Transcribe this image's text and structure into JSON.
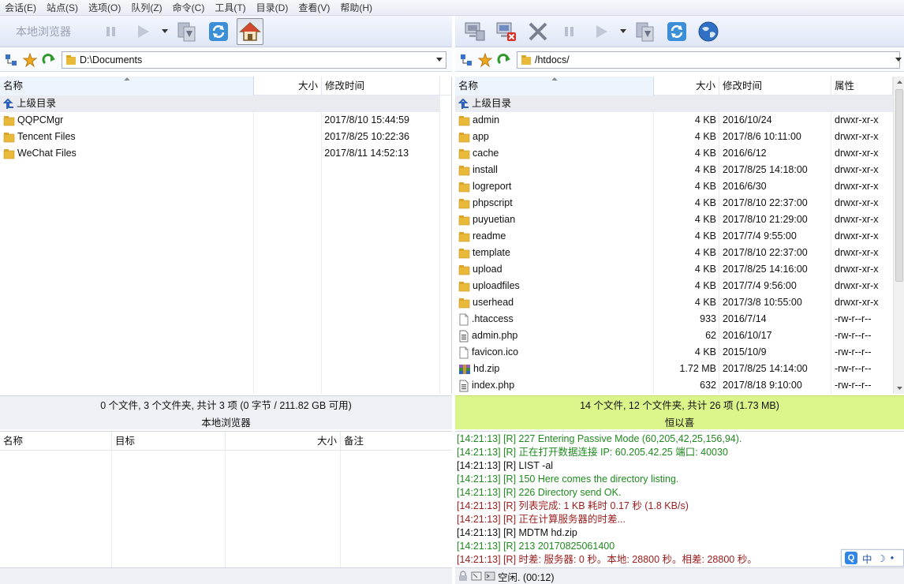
{
  "menu": [
    "会话(E)",
    "站点(S)",
    "选项(O)",
    "队列(Z)",
    "命令(C)",
    "工具(T)",
    "目录(D)",
    "查看(V)",
    "帮助(H)"
  ],
  "local_toolbar": {
    "title": "本地浏览器"
  },
  "local_path": "D:\\Documents",
  "remote_path": "/htdocs/",
  "local_headers": {
    "name": "名称",
    "size": "大小",
    "modified": "修改时间"
  },
  "remote_headers": {
    "name": "名称",
    "size": "大小",
    "modified": "修改时间",
    "attr": "属性"
  },
  "parent_dir_label": "上级目录",
  "local_files": [
    {
      "name": "QQPCMgr",
      "modified": "2017/8/10 15:44:59"
    },
    {
      "name": "Tencent Files",
      "modified": "2017/8/25 10:22:36"
    },
    {
      "name": "WeChat Files",
      "modified": "2017/8/11 14:52:13"
    }
  ],
  "remote_files": [
    {
      "name": "admin",
      "type": "folder",
      "size": "4 KB",
      "modified": "2016/10/24",
      "attr": "drwxr-xr-x"
    },
    {
      "name": "app",
      "type": "folder",
      "size": "4 KB",
      "modified": "2017/8/6 10:11:00",
      "attr": "drwxr-xr-x"
    },
    {
      "name": "cache",
      "type": "folder",
      "size": "4 KB",
      "modified": "2016/6/12",
      "attr": "drwxr-xr-x"
    },
    {
      "name": "install",
      "type": "folder",
      "size": "4 KB",
      "modified": "2017/8/25 14:18:00",
      "attr": "drwxr-xr-x"
    },
    {
      "name": "logreport",
      "type": "folder",
      "size": "4 KB",
      "modified": "2016/6/30",
      "attr": "drwxr-xr-x"
    },
    {
      "name": "phpscript",
      "type": "folder",
      "size": "4 KB",
      "modified": "2017/8/10 22:37:00",
      "attr": "drwxr-xr-x"
    },
    {
      "name": "puyuetian",
      "type": "folder",
      "size": "4 KB",
      "modified": "2017/8/10 21:29:00",
      "attr": "drwxr-xr-x"
    },
    {
      "name": "readme",
      "type": "folder",
      "size": "4 KB",
      "modified": "2017/7/4 9:55:00",
      "attr": "drwxr-xr-x"
    },
    {
      "name": "template",
      "type": "folder",
      "size": "4 KB",
      "modified": "2017/8/10 22:37:00",
      "attr": "drwxr-xr-x"
    },
    {
      "name": "upload",
      "type": "folder",
      "size": "4 KB",
      "modified": "2017/8/25 14:16:00",
      "attr": "drwxr-xr-x"
    },
    {
      "name": "uploadfiles",
      "type": "folder",
      "size": "4 KB",
      "modified": "2017/7/4 9:56:00",
      "attr": "drwxr-xr-x"
    },
    {
      "name": "userhead",
      "type": "folder",
      "size": "4 KB",
      "modified": "2017/3/8 10:55:00",
      "attr": "drwxr-xr-x"
    },
    {
      "name": ".htaccess",
      "type": "file",
      "size": "933",
      "modified": "2016/7/14",
      "attr": "-rw-r--r--"
    },
    {
      "name": "admin.php",
      "type": "php",
      "size": "62",
      "modified": "2016/10/17",
      "attr": "-rw-r--r--"
    },
    {
      "name": "favicon.ico",
      "type": "file",
      "size": "4 KB",
      "modified": "2015/10/9",
      "attr": "-rw-r--r--"
    },
    {
      "name": "hd.zip",
      "type": "zip",
      "size": "1.72 MB",
      "modified": "2017/8/25 14:14:00",
      "attr": "-rw-r--r--"
    },
    {
      "name": "index.php",
      "type": "php",
      "size": "632",
      "modified": "2017/8/18 9:10:00",
      "attr": "-rw-r--r--"
    }
  ],
  "local_status": {
    "summary": "0 个文件, 3 个文件夹, 共计 3 项 (0 字节 / 211.82 GB 可用)",
    "title": "本地浏览器"
  },
  "remote_status": {
    "summary": "14 个文件, 12 个文件夹, 共计 26 项 (1.73 MB)",
    "title": "恒以喜"
  },
  "queue_headers": {
    "name": "名称",
    "target": "目标",
    "size": "大小",
    "note": "备注"
  },
  "log": [
    {
      "text": "[14:21:13]  [R] 227 Entering Passive Mode (60,205,42,25,156,94).",
      "color": "#1f8a1f"
    },
    {
      "text": "[14:21:13]  [R] 正在打开数据连接 IP: 60.205.42.25 端口: 40030",
      "color": "#1f8a1f"
    },
    {
      "text": "[14:21:13]  [R] LIST -al",
      "color": "#111111"
    },
    {
      "text": "[14:21:13]  [R] 150 Here comes the directory listing.",
      "color": "#1f8a1f"
    },
    {
      "text": "[14:21:13]  [R] 226 Directory send OK.",
      "color": "#1f8a1f"
    },
    {
      "text": "[14:21:13]  [R] 列表完成: 1 KB 耗时 0.17 秒 (1.8 KB/s)",
      "color": "#9a1c1c"
    },
    {
      "text": "[14:21:13]  [R] 正在计算服务器的时差...",
      "color": "#9a1c1c"
    },
    {
      "text": "[14:21:13]  [R] MDTM hd.zip",
      "color": "#111111"
    },
    {
      "text": "[14:21:13]  [R] 213 20170825061400",
      "color": "#1f8a1f"
    },
    {
      "text": "[14:21:13]  [R] 时差: 服务器: 0 秒。本地: 28800 秒。相差: 28800 秒。",
      "color": "#9a1c1c"
    }
  ],
  "bottom_status": "空闲. (00:12)",
  "ime": {
    "q": "Q",
    "mode": "中",
    "moon": "☽",
    "dot": "•"
  },
  "icons": {
    "folder_color": "#e9b93a",
    "up_arrow_color": "#2d62b8"
  }
}
